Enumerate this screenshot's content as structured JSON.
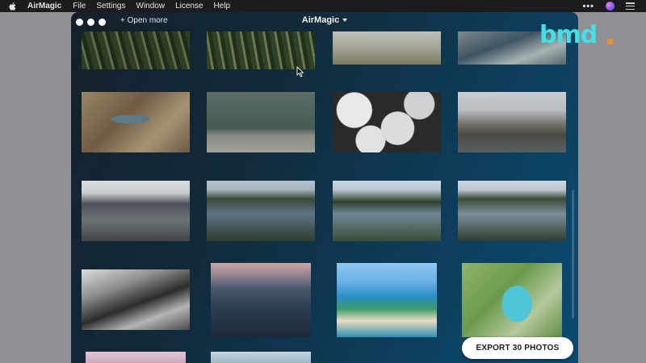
{
  "menubar": {
    "app_name": "AirMagic",
    "items": [
      "File",
      "Settings",
      "Window",
      "License",
      "Help"
    ],
    "overflow": "•••"
  },
  "window": {
    "title": "AirMagic",
    "open_more": "+ Open more",
    "export_button": "EXPORT 30 PHOTOS"
  },
  "watermark": {
    "text": "bmd"
  },
  "photos": [
    "fields-1",
    "fields-2",
    "field-sand",
    "river-snow",
    "winding",
    "dam",
    "ice",
    "houses",
    "bridge",
    "lake-forest",
    "bay-1",
    "bay-2",
    "bw",
    "sunset",
    "tropic",
    "aqua",
    "pink",
    "sky"
  ]
}
